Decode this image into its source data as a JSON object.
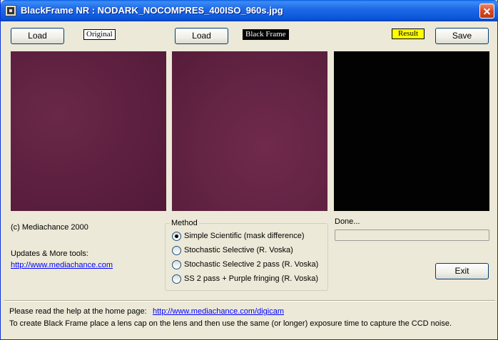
{
  "window": {
    "title": "BlackFrame NR : NODARK_NOCOMPRES_400ISO_960s.jpg"
  },
  "toolbar": {
    "load_original_label": "Load",
    "original_tag": "Original",
    "load_black_label": "Load",
    "black_tag": "Black Frame",
    "result_tag": "Result",
    "save_label": "Save"
  },
  "info": {
    "copyright": "(c) Mediachance 2000",
    "updates_label": "Updates & More tools:",
    "updates_link": "http://www.mediachance.com"
  },
  "method": {
    "title": "Method",
    "options": [
      {
        "label": "Simple Scientific (mask difference)",
        "selected": true
      },
      {
        "label": "Stochastic Selective (R. Voska)",
        "selected": false
      },
      {
        "label": "Stochastic Selective  2 pass (R. Voska)",
        "selected": false
      },
      {
        "label": "SS  2 pass + Purple fringing (R. Voska)",
        "selected": false
      }
    ]
  },
  "status": {
    "text": "Done...",
    "progress": 0
  },
  "exit_label": "Exit",
  "footer": {
    "help_text": "Please read the help at the home page:",
    "help_link": "http://www.mediachance.com/digicam",
    "instructions": "To create Black Frame place a lens cap on the lens and then use the same (or longer) exposure time to capture the CCD noise."
  },
  "colors": {
    "titlebar": "#0a56d8",
    "result_tag_bg": "#ffff00",
    "preview_purple": "#5e2040",
    "preview_black": "#020202",
    "link": "#0000ff"
  }
}
